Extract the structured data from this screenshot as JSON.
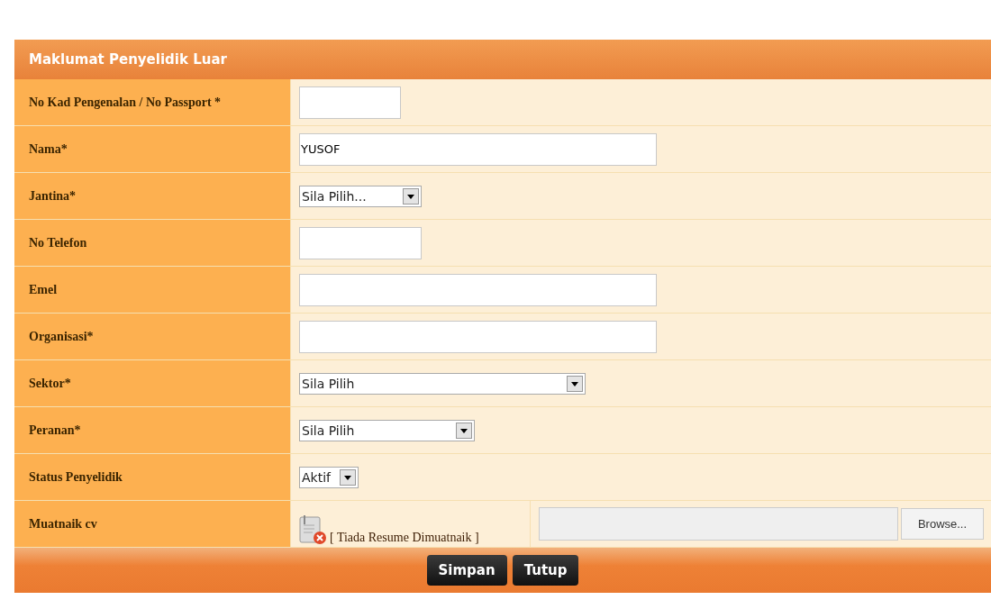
{
  "panel": {
    "title": "Maklumat Penyelidik Luar"
  },
  "fields": [
    {
      "label": "No Kad Pengenalan / No Passport *",
      "kind": "text"
    },
    {
      "label": "Nama*",
      "kind": "text",
      "value": "YUSOF"
    },
    {
      "label": "Jantina*",
      "kind": "select",
      "value": "Sila Pilih..."
    },
    {
      "label": "No Telefon",
      "kind": "text"
    },
    {
      "label": "Emel",
      "kind": "text"
    },
    {
      "label": "Organisasi*",
      "kind": "text"
    },
    {
      "label": "Sektor*",
      "kind": "select",
      "value": "Sila Pilih"
    },
    {
      "label": "Peranan*",
      "kind": "select",
      "value": "Sila Pilih"
    },
    {
      "label": "Status Penyelidik",
      "kind": "select",
      "value": "Aktif"
    },
    {
      "label": "Muatnaik cv",
      "kind": "file",
      "status": "[ Tiada Resume Dimuatnaik ]",
      "browse": "Browse..."
    }
  ],
  "buttons": [
    "Simpan",
    "Tutup"
  ]
}
